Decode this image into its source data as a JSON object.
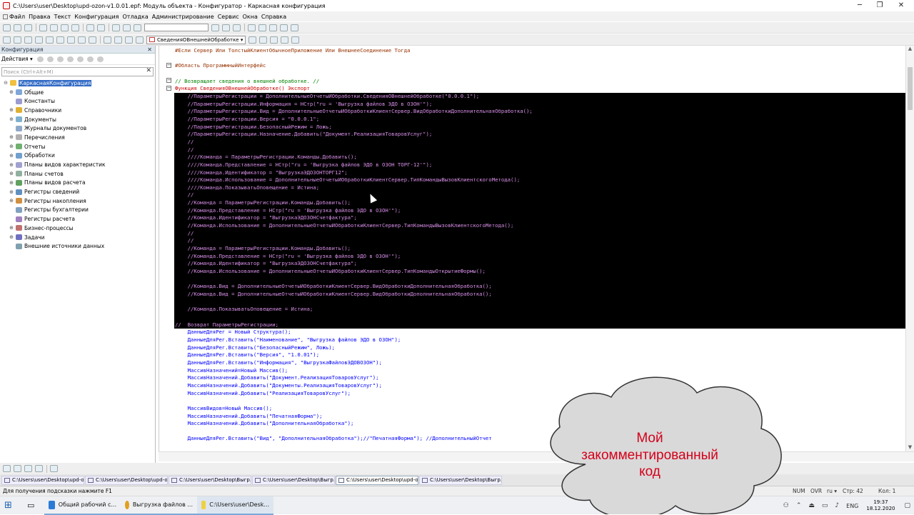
{
  "window": {
    "title": "C:\\Users\\user\\Desktop\\upd-ozon-v1.0.01.epf: Модуль объекта - Конфигуратор - Каркасная конфигурация",
    "controls": [
      "─",
      "❐",
      "✕"
    ]
  },
  "menu": [
    "Файл",
    "Правка",
    "Текст",
    "Конфигурация",
    "Отладка",
    "Администрирование",
    "Сервис",
    "Окна",
    "Справка"
  ],
  "toolbar2": {
    "procedure_selector": "СведенияОВнешнейОбработке"
  },
  "left_panel": {
    "title": "Конфигурация",
    "close": "✕",
    "actions_label": "Действия ▾",
    "search_placeholder": "Поиск (Ctrl+Alt+M)",
    "search_clear": "✕",
    "tree": [
      {
        "label": "КаркаснаяКонфигурация",
        "root": true,
        "expand": "⊖",
        "color": "#f0c040"
      },
      {
        "label": "Общие",
        "expand": "⊕",
        "color": "#7fa7d9"
      },
      {
        "label": "Константы",
        "expand": "",
        "color": "#9b9bd0"
      },
      {
        "label": "Справочники",
        "expand": "⊕",
        "color": "#e0b030"
      },
      {
        "label": "Документы",
        "expand": "⊕",
        "color": "#7fb0d0"
      },
      {
        "label": "Журналы документов",
        "expand": "",
        "color": "#8fa8c8"
      },
      {
        "label": "Перечисления",
        "expand": "⊕",
        "color": "#b0b0b0"
      },
      {
        "label": "Отчеты",
        "expand": "⊕",
        "color": "#70b070"
      },
      {
        "label": "Обработки",
        "expand": "⊕",
        "color": "#70a0d0"
      },
      {
        "label": "Планы видов характеристик",
        "expand": "⊕",
        "color": "#a0a0d0"
      },
      {
        "label": "Планы счетов",
        "expand": "⊕",
        "color": "#90b0a0"
      },
      {
        "label": "Планы видов расчета",
        "expand": "⊕",
        "color": "#60a060"
      },
      {
        "label": "Регистры сведений",
        "expand": "⊕",
        "color": "#6090c0"
      },
      {
        "label": "Регистры накопления",
        "expand": "⊕",
        "color": "#d09040"
      },
      {
        "label": "Регистры бухгалтерии",
        "expand": "",
        "color": "#80a0c0"
      },
      {
        "label": "Регистры расчета",
        "expand": "",
        "color": "#a080c0"
      },
      {
        "label": "Бизнес-процессы",
        "expand": "⊕",
        "color": "#c07070"
      },
      {
        "label": "Задачи",
        "expand": "⊕",
        "color": "#7070c0"
      },
      {
        "label": "Внешние источники данных",
        "expand": "",
        "color": "#80a0b0"
      }
    ]
  },
  "code": {
    "lines": [
      {
        "text": "#Если Сервер Или ТолстыйКлиентОбычноеПриложение Или ВнешнееСоединение Тогда",
        "style": "dir"
      },
      {
        "text": "",
        "style": "plain"
      },
      {
        "text": "#Область ПрограммныйИнтерфейс",
        "style": "dir"
      },
      {
        "text": "",
        "style": "plain"
      },
      {
        "text": "// Возвращает сведения о внешней обработке. //",
        "style": "com"
      },
      {
        "text": "Функция СведенияОВнешнейОбработке() Экспорт",
        "style": "kw"
      },
      {
        "text": "    //ПараметрыРегистрации = ДополнительныеОтчетыИОбработки.СведенияОВнешнейОбработке(\"0.0.0.1\");",
        "style": "sel"
      },
      {
        "text": "    //ПараметрыРегистрации.Информация = НСтр(\"ru = 'Выгрузка файлов ЭДО в ОЗОН'\");",
        "style": "sel"
      },
      {
        "text": "    //ПараметрыРегистрации.Вид = ДополнительныеОтчетыИОбработкиКлиентСервер.ВидОбработкиДополнительнаяОбработка();",
        "style": "sel"
      },
      {
        "text": "    //ПараметрыРегистрации.Версия = \"0.0.0.1\";",
        "style": "sel"
      },
      {
        "text": "    //ПараметрыРегистрации.БезопасныйРежим = Ложь;",
        "style": "sel"
      },
      {
        "text": "    //ПараметрыРегистрации.Назначение.Добавить(\"Документ.РеализацияТоваровУслуг\");",
        "style": "sel"
      },
      {
        "text": "    //",
        "style": "sel"
      },
      {
        "text": "    //",
        "style": "sel"
      },
      {
        "text": "    ////Команда = ПараметрыРегистрации.Команды.Добавить();",
        "style": "sel"
      },
      {
        "text": "    ////Команда.Представление = НСтр(\"ru = 'Выгрузка файлов ЭДО в ОЗОН ТОРГ-12'\");",
        "style": "sel"
      },
      {
        "text": "    ////Команда.Идентификатор = \"ВыгрузкаЭДОЗОНТОРГ12\";",
        "style": "sel"
      },
      {
        "text": "    ////Команда.Использование = ДополнительныеОтчетыИОбработкиКлиентСервер.ТипКомандыВызовКлиентскогоМетода();",
        "style": "sel"
      },
      {
        "text": "    ////Команда.ПоказыватьОповещение = Истина;",
        "style": "sel"
      },
      {
        "text": "    //",
        "style": "sel"
      },
      {
        "text": "    //Команда = ПараметрыРегистрации.Команды.Добавить();",
        "style": "sel"
      },
      {
        "text": "    //Команда.Представление = НСтр(\"ru = 'Выгрузка файлов ЭДО в ОЗОН'\");",
        "style": "sel"
      },
      {
        "text": "    //Команда.Идентификатор = \"ВыгрузкаЭДОЗОНСчетфактура\";",
        "style": "sel"
      },
      {
        "text": "    //Команда.Использование = ДополнительныеОтчетыИОбработкиКлиентСервер.ТипКомандыВызовКлиентскогоМетода();",
        "style": "sel"
      },
      {
        "text": "    //",
        "style": "sel"
      },
      {
        "text": "    //",
        "style": "sel"
      },
      {
        "text": "    //Команда = ПараметрыРегистрации.Команды.Добавить();",
        "style": "sel"
      },
      {
        "text": "    //Команда.Представление = НСтр(\"ru = 'Выгрузка файлов ЭДО в ОЗОН'\");",
        "style": "sel"
      },
      {
        "text": "    //Команда.Идентификатор = \"ВыгрузкаЭДОЗОНСчетфактура\";",
        "style": "sel"
      },
      {
        "text": "    //Команда.Использование = ДополнительныеОтчетыИОбработкиКлиентСервер.ТипКомандыОткрытиеФормы();",
        "style": "sel"
      },
      {
        "text": "",
        "style": "sel"
      },
      {
        "text": "    //Команда.Вид = ДополнительныеОтчетыИОбработкиКлиентСервер.ВидОбработкиДополнительнаяОбработка();",
        "style": "sel"
      },
      {
        "text": "    //Команда.Вид = ДополнительныеОтчетыИОбработкиКлиентСервер.ВидОбработкиДополнительнаяОбработка();",
        "style": "sel"
      },
      {
        "text": "",
        "style": "sel"
      },
      {
        "text": "    //Команда.ПоказыватьОповещение = Истина;",
        "style": "sel"
      },
      {
        "text": "",
        "style": "sel"
      },
      {
        "text": "//  Возврат ПараметрыРегистрации;",
        "style": "sel"
      },
      {
        "text": "    ДанныеДляРег = Новый Структура();",
        "style": "id"
      },
      {
        "text": "    ДанныеДляРег.Вставить(\"Наименование\", \"Выгрузка файлов ЭДО в ОЗОН\");",
        "style": "id"
      },
      {
        "text": "    ДанныеДляРег.Вставить(\"БезопасныйРежим\", Ложь);",
        "style": "id"
      },
      {
        "text": "    ДанныеДляРег.Вставить(\"Версия\", \"1.0.01\");",
        "style": "id"
      },
      {
        "text": "    ДанныеДляРег.Вставить(\"Информация\", \"ВыгрузкаФайловЭДОВОЗОН\");",
        "style": "id"
      },
      {
        "text": "    МассивНазначений=Новый Массив();",
        "style": "id"
      },
      {
        "text": "    МассивНазначений.Добавить(\"Документ.РеализацияТоваровУслуг\");",
        "style": "id"
      },
      {
        "text": "    МассивНазначений.Добавить(\"Документы.РеализацияТоваровУслуг\");",
        "style": "id"
      },
      {
        "text": "    МассивНазначений.Добавить(\"РеализацияТоваровУслуг\");",
        "style": "id"
      },
      {
        "text": "",
        "style": "plain"
      },
      {
        "text": "    МассивВидов=Новый Массив();",
        "style": "id"
      },
      {
        "text": "    МассивНазначений.Добавить(\"ПечатнаяФорма\");",
        "style": "id"
      },
      {
        "text": "    МассивНазначений.Добавить(\"ДополнительнаяОбработка\");",
        "style": "id"
      },
      {
        "text": "",
        "style": "plain"
      },
      {
        "text": "    ДанныеДляРег.Вставить(\"Вид\", \"ДополнительнаяОбработка\");//\"ПечатнаяФорма\"); //ДополнительныйОтчет",
        "style": "id"
      }
    ]
  },
  "window_tabs": [
    "C:\\Users\\user\\Desktop\\upd-o...",
    "C:\\Users\\user\\Desktop\\upd-o...",
    "C:\\Users\\user\\Desktop\\Выгр...",
    "C:\\Users\\user\\Desktop\\Выгр...",
    "C:\\Users\\user\\Desktop\\upd-o...",
    "C:\\Users\\user\\Desktop\\Выгр..."
  ],
  "status": {
    "hint": "Для получения подсказки нажмите F1",
    "num": "NUM",
    "ovr": "OVR",
    "lang": "ru ▾",
    "line": "Стр: 42",
    "col": "Кол: 1"
  },
  "taskbar": {
    "apps": [
      {
        "label": "Общий рабочий с...",
        "color": "#2b7bd6"
      },
      {
        "label": "Выгрузка файлов ...",
        "color": "#e0a020"
      },
      {
        "label": "C:\\Users\\user\\Desk...",
        "color": "#f0d040"
      }
    ],
    "tray_lang": "ENG",
    "time": "19:37",
    "date": "18.12.2020"
  },
  "overlay": {
    "cloud_text_1": "Мой",
    "cloud_text_2": "закомментированный",
    "cloud_text_3": "код"
  }
}
